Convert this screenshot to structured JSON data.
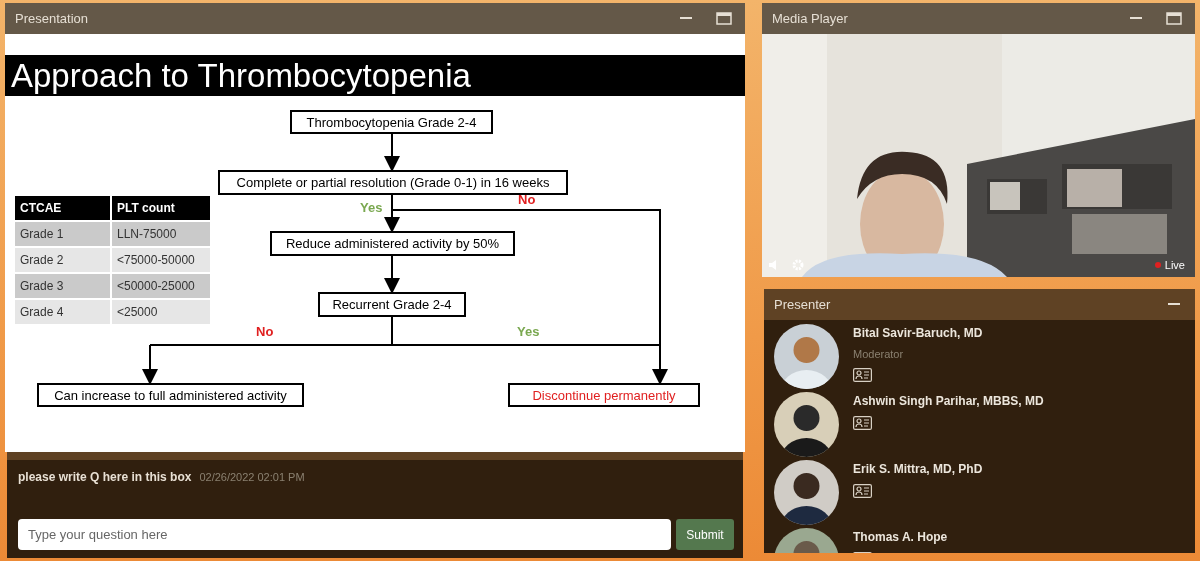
{
  "presentation": {
    "title": "Presentation",
    "slide_title": "Approach to Thrombocytopenia",
    "table": {
      "columns": [
        "CTCAE",
        "PLT count"
      ],
      "rows": [
        [
          "Grade 1",
          "LLN-75000"
        ],
        [
          "Grade 2",
          "<75000-50000"
        ],
        [
          "Grade 3",
          "<50000-25000"
        ],
        [
          "Grade 4",
          "<25000"
        ]
      ]
    },
    "flow_boxes": [
      {
        "text": "Thrombocytopenia Grade 2-4",
        "kind": "normal"
      },
      {
        "text": "Complete or partial resolution (Grade 0-1) in 16 weeks",
        "kind": "normal"
      },
      {
        "text": "Reduce administered activity by 50%",
        "kind": "normal"
      },
      {
        "text": "Recurrent Grade 2-4",
        "kind": "normal"
      },
      {
        "text": "Can increase to full administered activity",
        "kind": "normal"
      },
      {
        "text": "Discontinue permanently",
        "kind": "alert"
      }
    ],
    "flow_labels": [
      {
        "text": "Yes",
        "kind": "yes"
      },
      {
        "text": "No",
        "kind": "no"
      },
      {
        "text": "No",
        "kind": "no"
      },
      {
        "text": "Yes",
        "kind": "yes"
      }
    ]
  },
  "questions": {
    "message": "please write Q here in this box",
    "timestamp": "02/26/2022 02:01 PM",
    "input": {
      "placeholder": "Type your question here"
    },
    "submit": "Submit"
  },
  "media_player": {
    "title": "Media Player",
    "status": "Live"
  },
  "presenters": {
    "title": "Presenter",
    "people": [
      {
        "name": "Bital Savir-Baruch, MD",
        "role": "Moderator"
      },
      {
        "name": "Ashwin Singh Parihar, MBBS, MD"
      },
      {
        "name": "Erik S. Mittra, MD, PhD"
      },
      {
        "name": "Thomas A. Hope"
      }
    ]
  }
}
